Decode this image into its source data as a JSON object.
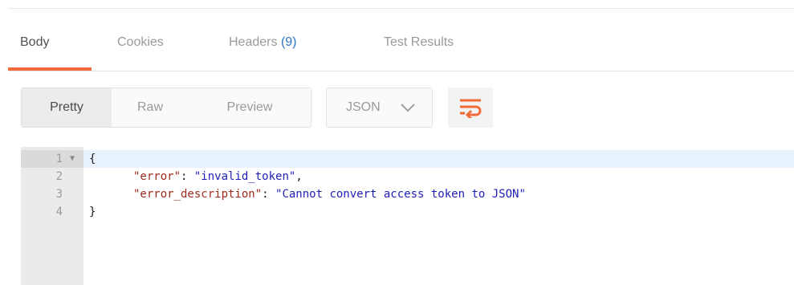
{
  "tabs": [
    {
      "label": "Body",
      "active": true
    },
    {
      "label": "Cookies",
      "active": false
    },
    {
      "label": "Headers",
      "count": "(9)",
      "active": false
    },
    {
      "label": "Test Results",
      "active": false
    }
  ],
  "view_modes": [
    {
      "label": "Pretty",
      "active": true
    },
    {
      "label": "Raw",
      "active": false
    },
    {
      "label": "Preview",
      "active": false
    }
  ],
  "format": {
    "selected": "JSON",
    "icon": "chevron-down-icon"
  },
  "wrap_button": {
    "icon": "wrap-lines-icon",
    "color": "#f26b3a"
  },
  "editor": {
    "lines": [
      {
        "number": "1",
        "open_brace": "{"
      },
      {
        "number": "2",
        "key": "\"error\"",
        "value": "\"invalid_token\"",
        "trailing": ","
      },
      {
        "number": "3",
        "key": "\"error_description\"",
        "value": "\"Cannot convert access token to JSON\"",
        "trailing": ""
      },
      {
        "number": "4",
        "close_brace": "}"
      }
    ]
  },
  "colors": {
    "accent": "#f26b3a",
    "json_key": "#9e2a1b",
    "json_string": "#1f1fb8",
    "link_count": "#2b77c9"
  }
}
